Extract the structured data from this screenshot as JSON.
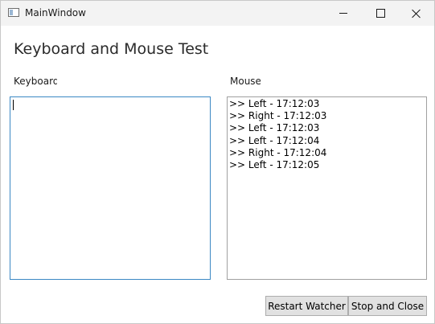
{
  "window": {
    "title": "MainWindow",
    "controls": [
      "minimize-icon",
      "maximize-icon",
      "close-icon"
    ]
  },
  "heading": "Keyboard and Mouse Test",
  "keyboard": {
    "label": "Keyboard",
    "value": ""
  },
  "mouse": {
    "label": "Mouse",
    "items": [
      ">> Left - 17:12:03",
      ">> Right - 17:12:03",
      ">> Left - 17:12:03",
      ">> Left - 17:12:04",
      ">> Right - 17:12:04",
      ">> Left - 17:12:05"
    ]
  },
  "buttons": {
    "restart": "Restart Watcher",
    "stop": "Stop and Close"
  }
}
